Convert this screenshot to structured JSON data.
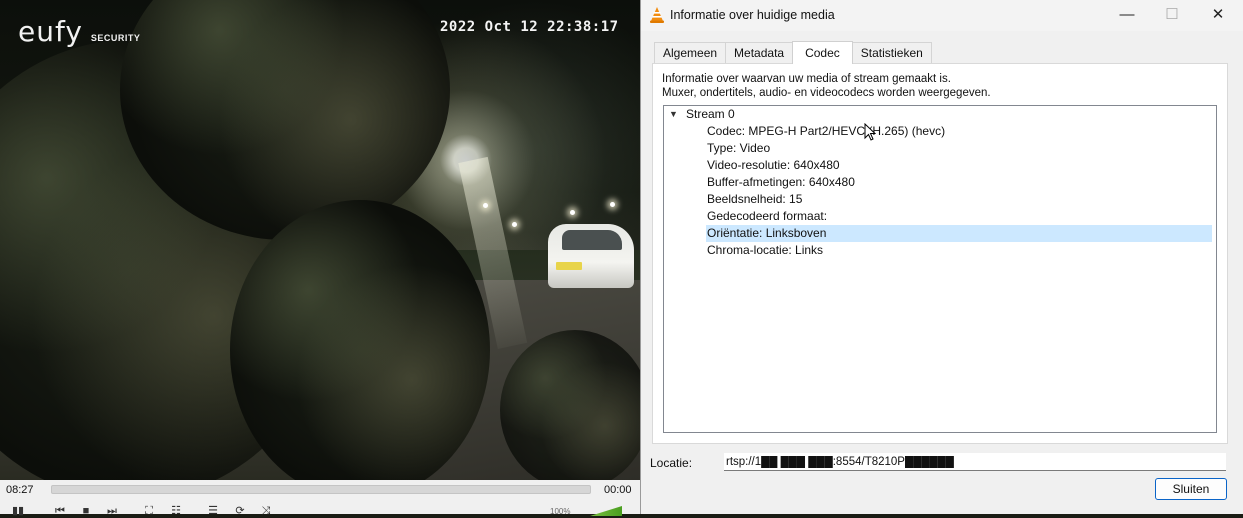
{
  "player": {
    "logo_text": "eufy",
    "logo_sub": "SECURITY",
    "timestamp": "2022 Oct 12 22:38:17",
    "time_elapsed": "08:27",
    "time_total": "00:00",
    "volume": "100%",
    "progress": 0,
    "controls": [
      "pause-icon",
      "previous-icon",
      "stop-icon",
      "next-icon",
      "fullscreen-icon",
      "extended-settings-icon",
      "playlist-icon",
      "loop-icon",
      "shuffle-icon"
    ]
  },
  "dialog": {
    "title": "Informatie over huidige media",
    "icon": "vlc-cone-icon",
    "window_buttons": {
      "minimize": "—",
      "maximize": "☐",
      "close": "✕"
    },
    "tabs": [
      {
        "label": "Algemeen",
        "active": false
      },
      {
        "label": "Metadata",
        "active": false
      },
      {
        "label": "Codec",
        "active": true
      },
      {
        "label": "Statistieken",
        "active": false
      }
    ],
    "description_line1": "Informatie over waarvan uw media of stream gemaakt is.",
    "description_line2": "Muxer, ondertitels, audio- en videocodecs worden weergegeven.",
    "stream": {
      "label": "Stream 0",
      "expanded": true,
      "items": [
        {
          "text": "Codec: MPEG-H Part2/HEVC (H.265) (hevc)",
          "selected": false
        },
        {
          "text": "Type: Video",
          "selected": false
        },
        {
          "text": "Video-resolutie: 640x480",
          "selected": false
        },
        {
          "text": "Buffer-afmetingen: 640x480",
          "selected": false
        },
        {
          "text": "Beeldsnelheid: 15",
          "selected": false
        },
        {
          "text": "Gedecodeerd formaat:",
          "selected": false
        },
        {
          "text": "Oriëntatie: Linksboven",
          "selected": true
        },
        {
          "text": "Chroma-locatie: Links",
          "selected": false
        }
      ]
    },
    "location_label": "Locatie:",
    "location_value": "rtsp://1██ ███ ███:8554/T8210P██████",
    "close_label": "Sluiten"
  },
  "colors": {
    "selection": "#cce8ff",
    "default_button_border": "#0a64c8",
    "vlc_orange": "#f28c0f"
  }
}
